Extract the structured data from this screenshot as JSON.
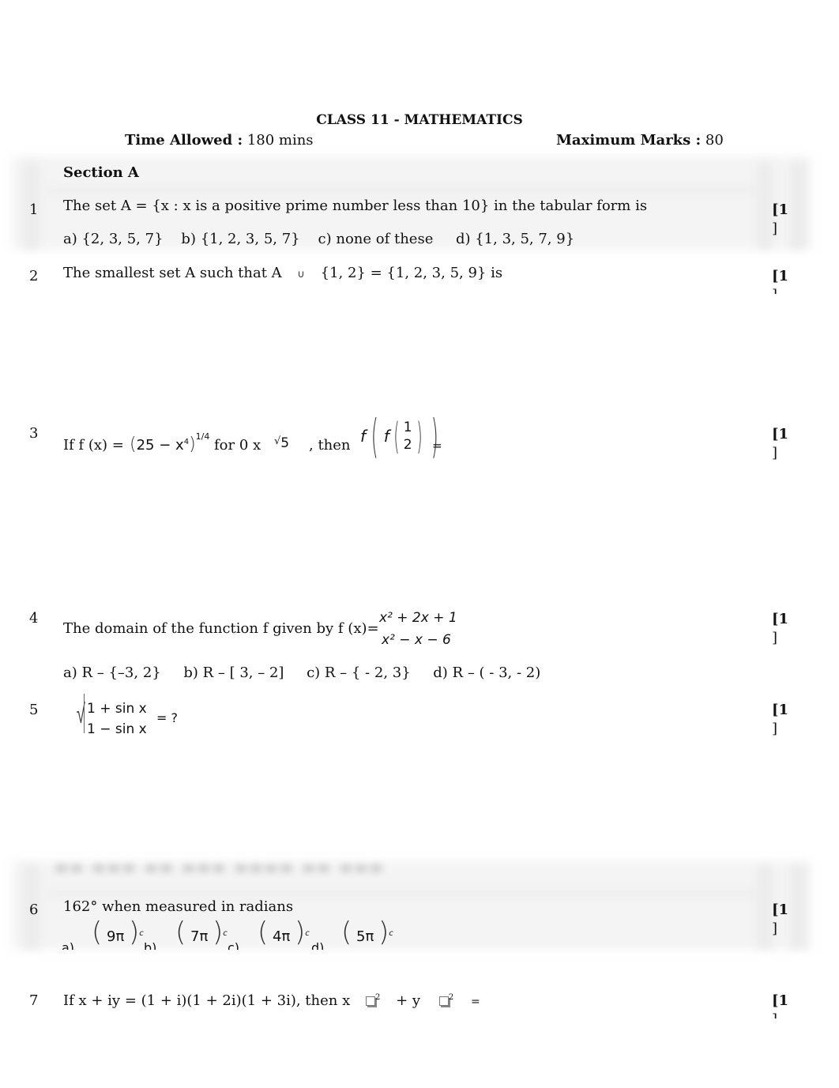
{
  "header": {
    "title": "CLASS 11 - MATHEMATICS",
    "time_label": "Time Allowed :",
    "time_value": " 180 mins",
    "marks_label": "Maximum Marks :",
    "marks_value": " 80"
  },
  "section": {
    "label": "Section A"
  },
  "questions": [
    {
      "number": "1",
      "text": "The set A = {x : x is a positive prime number less than 10} in the tabular form is",
      "options": [
        "a) {2, 3, 5, 7}",
        "b) {1, 2, 3, 5, 7}",
        "c) none of these",
        "d) {1, 3, 5, 7, 9}"
      ],
      "marks_open": "[1",
      "marks_close": "]"
    },
    {
      "number": "2",
      "text_before": "The smallest set A such that A",
      "union_symbol": "∪",
      "text_after": "{1, 2} = {1, 2, 3, 5, 9} is",
      "marks_open": "[1",
      "marks_close": "]"
    },
    {
      "number": "3",
      "text_prefix": "If f (x) =",
      "expr_base": "25 − x",
      "expr_exp_inner": "4",
      "expr_power": "1/4",
      "text_mid": "for 0 x",
      "root_symbol": "√",
      "root_value": "5",
      "text_then": ", then",
      "f_outer": "f",
      "f_inner": "f",
      "frac_num": "1",
      "frac_den": "2",
      "equals": "=",
      "marks_open": "[1",
      "marks_close": "]"
    },
    {
      "number": "4",
      "text": "The domain of the function f given by f (x)=",
      "numerator": "x² + 2x + 1",
      "denominator": "x² − x − 6",
      "options": [
        "a) R – {–3, 2}",
        "b) R – [ 3, – 2]",
        "c) R – { -  2, 3}",
        "d) R – ( -  3, -  2)"
      ],
      "marks_open": "[1",
      "marks_close": "]"
    },
    {
      "number": "5",
      "root_symbol": "√",
      "numerator": "1 + sin x",
      "denominator": "1 − sin x",
      "text_after": "= ?",
      "marks_open": "[1",
      "marks_close": "]"
    },
    {
      "number": "6",
      "text": "162° when measured in radians",
      "options": [
        {
          "label": "a)",
          "value": "9π",
          "sup": "c"
        },
        {
          "label": "b)",
          "value": "7π",
          "sup": "c"
        },
        {
          "label": "c)",
          "value": "4π",
          "sup": "c"
        },
        {
          "label": "d)",
          "value": "5π",
          "sup": "c"
        }
      ],
      "marks_open": "[1",
      "marks_close": "]"
    },
    {
      "number": "7",
      "text_before": "If x + iy = (1 + i)(1 + 2i)(1 + 3i), then x",
      "sup1": "2",
      "text_mid": "+ y",
      "sup2": "2",
      "equals": "=",
      "marks_open": "[1",
      "marks_close": "]"
    }
  ]
}
